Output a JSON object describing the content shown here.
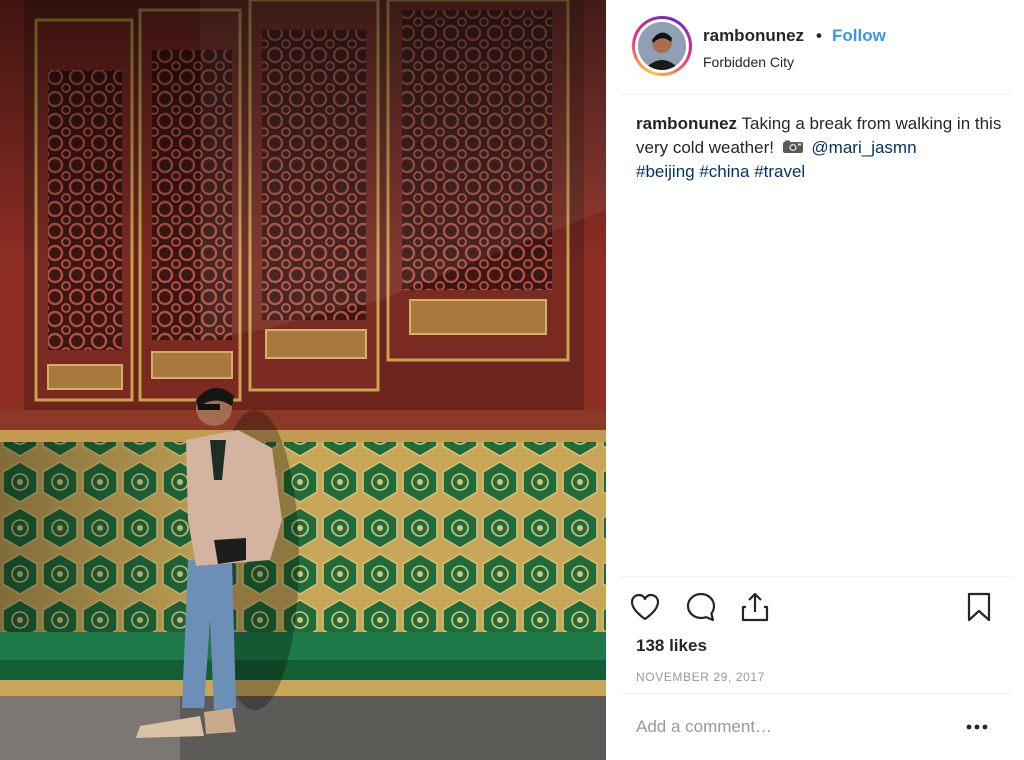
{
  "post": {
    "author": "rambonunez",
    "separator": "•",
    "follow_label": "Follow",
    "location": "Forbidden City",
    "caption": {
      "username": "rambonunez",
      "text_part1": "Taking a break from walking in this very cold weather!",
      "mention": "@mari_jasmn",
      "tags": [
        "#beijing",
        "#china",
        "#travel"
      ]
    },
    "likes": "138 likes",
    "date": "NOVEMBER 29, 2017",
    "comment_placeholder": "Add a comment…"
  },
  "icons": {
    "like": "heart-icon",
    "comment": "comment-bubble-icon",
    "share": "share-icon",
    "save": "bookmark-icon",
    "more": "more-options-icon",
    "caption_emoji": "camera-icon"
  },
  "colors": {
    "link_blue": "#3897f0",
    "hashtag_blue": "#003569",
    "text": "#262626",
    "muted": "#999999"
  }
}
